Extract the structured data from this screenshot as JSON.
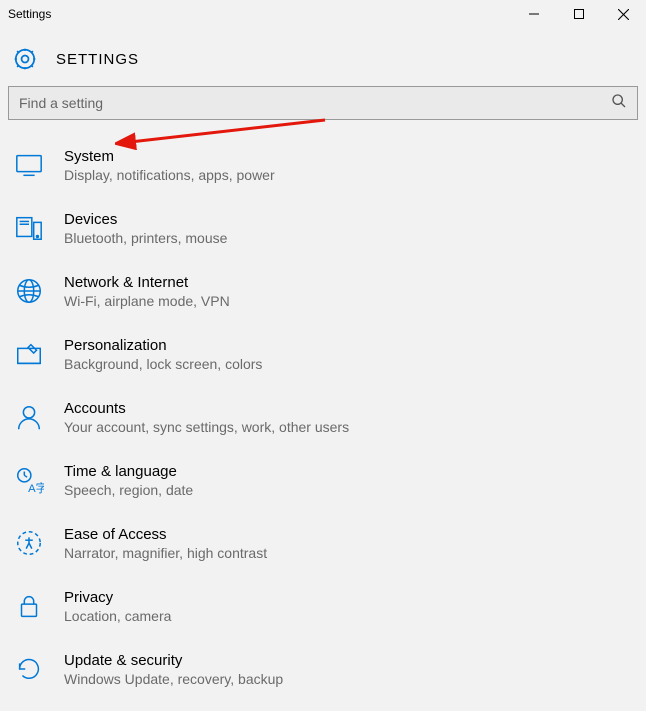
{
  "titlebar": "Settings",
  "header": {
    "title": "SETTINGS"
  },
  "search": {
    "placeholder": "Find a setting"
  },
  "categories": [
    {
      "key": "system",
      "title": "System",
      "desc": "Display, notifications, apps, power"
    },
    {
      "key": "devices",
      "title": "Devices",
      "desc": "Bluetooth, printers, mouse"
    },
    {
      "key": "network",
      "title": "Network & Internet",
      "desc": "Wi-Fi, airplane mode, VPN"
    },
    {
      "key": "personalization",
      "title": "Personalization",
      "desc": "Background, lock screen, colors"
    },
    {
      "key": "accounts",
      "title": "Accounts",
      "desc": "Your account, sync settings, work, other users"
    },
    {
      "key": "time",
      "title": "Time & language",
      "desc": "Speech, region, date"
    },
    {
      "key": "ease",
      "title": "Ease of Access",
      "desc": "Narrator, magnifier, high contrast"
    },
    {
      "key": "privacy",
      "title": "Privacy",
      "desc": "Location, camera"
    },
    {
      "key": "update",
      "title": "Update & security",
      "desc": "Windows Update, recovery, backup"
    }
  ]
}
